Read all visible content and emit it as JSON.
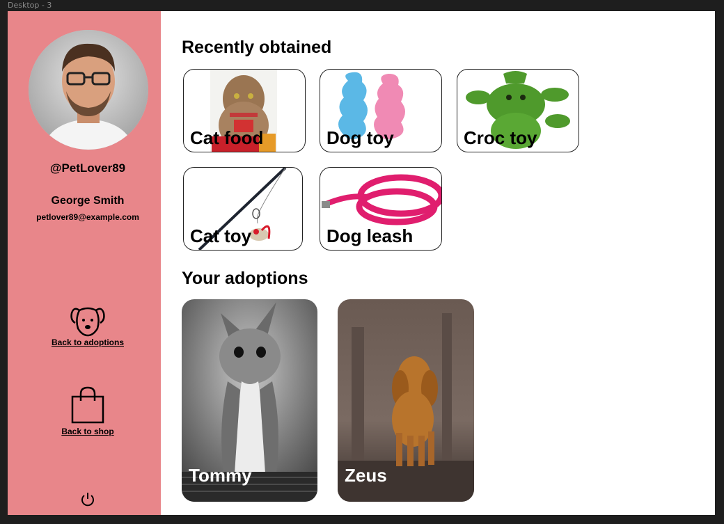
{
  "frame": {
    "label": "Desktop - 3"
  },
  "profile": {
    "handle": "@PetLover89",
    "name": "George Smith",
    "email": "petlover89@example.com"
  },
  "nav": {
    "adoptions_label": "Back to adoptions",
    "shop_label": "Back to shop",
    "icons": {
      "adoptions": "dog-face-icon",
      "shop": "shopping-bag-icon",
      "logout": "power-icon"
    }
  },
  "recent": {
    "title": "Recently obtained",
    "items": [
      {
        "label": "Cat food"
      },
      {
        "label": "Dog toy"
      },
      {
        "label": "Croc toy"
      },
      {
        "label": "Cat toy"
      },
      {
        "label": "Dog leash"
      }
    ]
  },
  "adoptions": {
    "title": "Your adoptions",
    "pets": [
      {
        "name": "Tommy"
      },
      {
        "name": "Zeus"
      }
    ]
  },
  "colors": {
    "sidebar": "#e8868a",
    "accent_pink": "#e01e6e"
  }
}
